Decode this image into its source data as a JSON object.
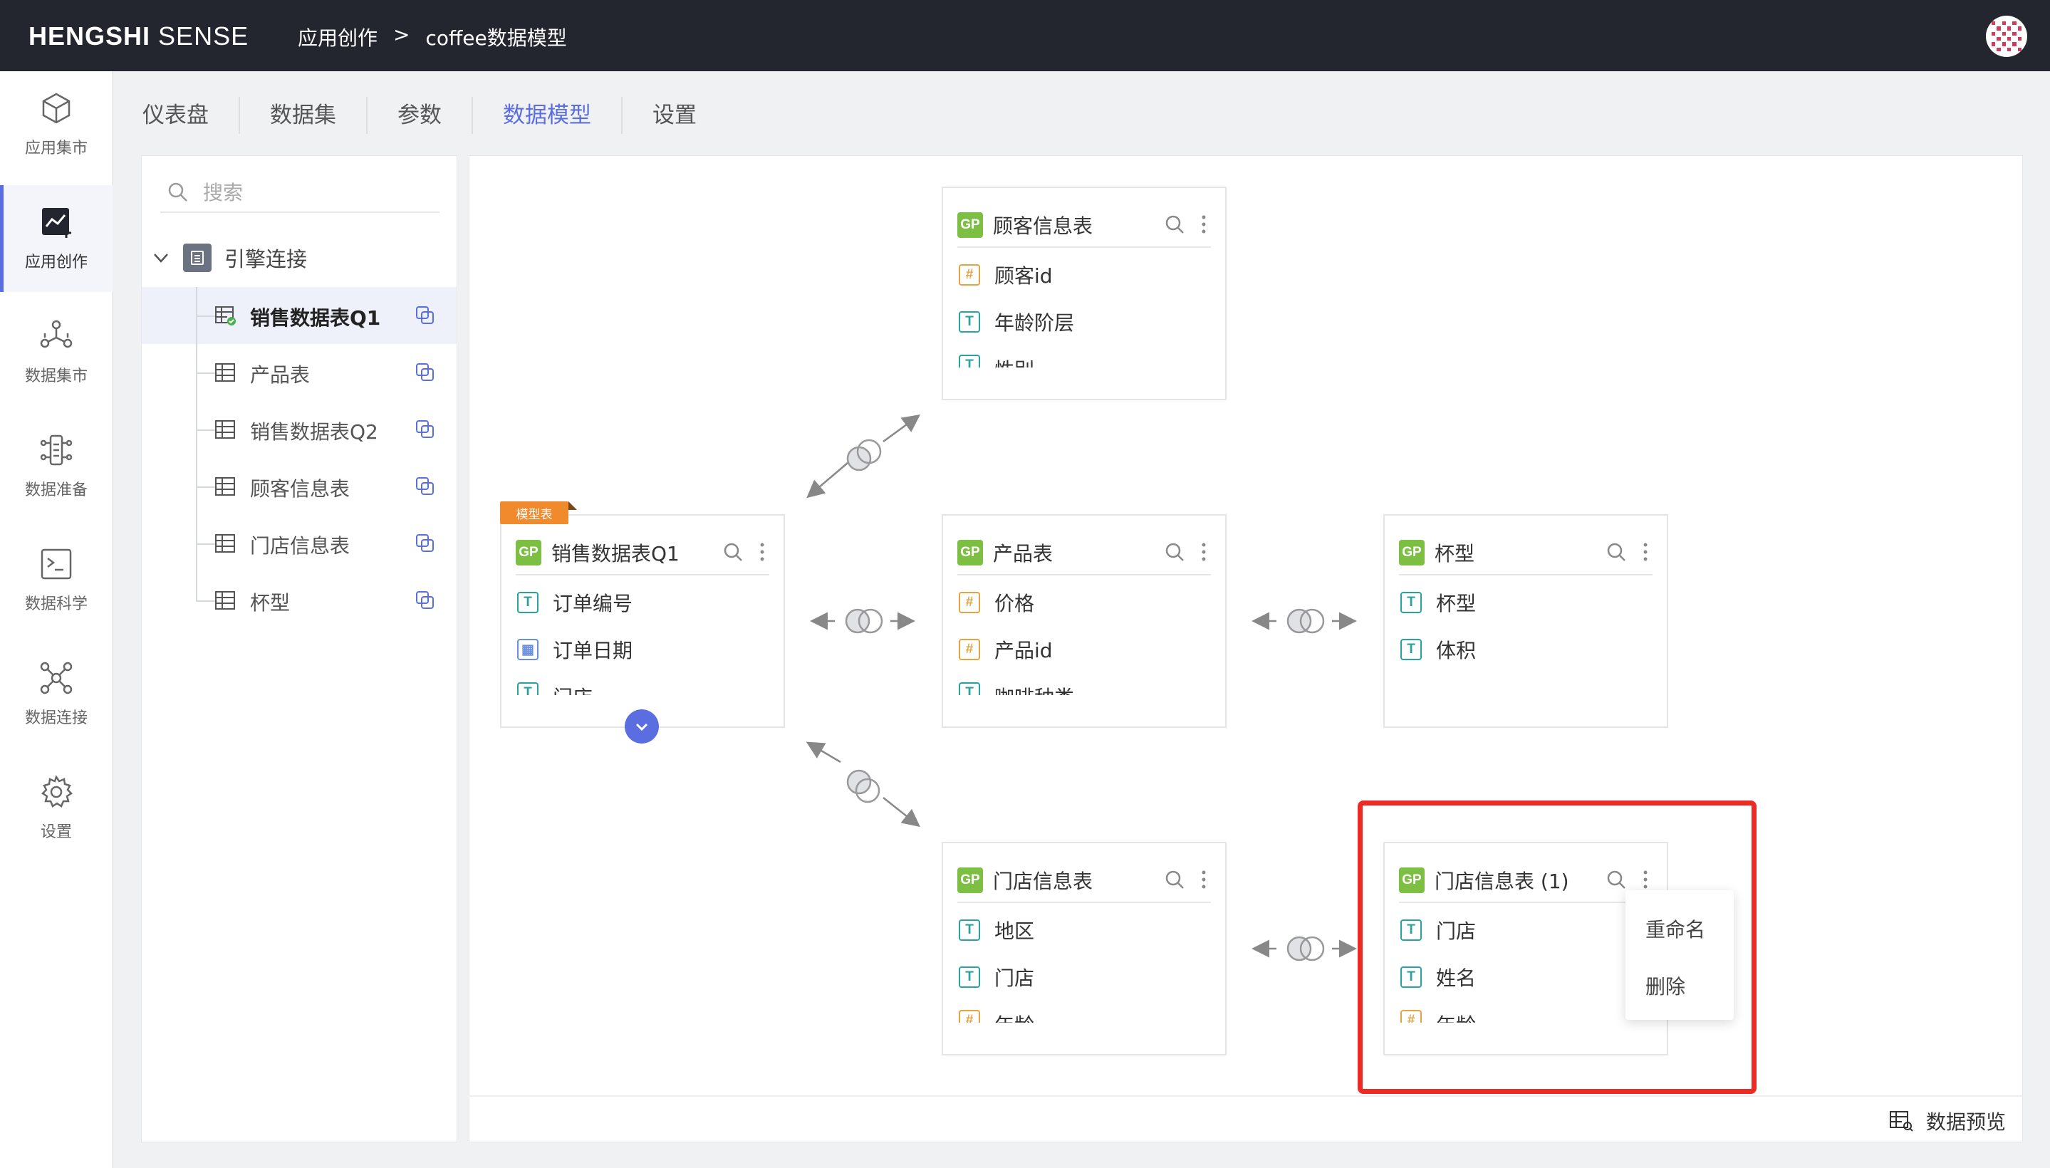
{
  "app": {
    "brand_bold": "HENGSHI",
    "brand_light": "SENSE",
    "breadcrumb": [
      "应用创作",
      ">",
      "coffee数据模型"
    ]
  },
  "leftnav": [
    {
      "label": "应用集市",
      "icon": "cube-icon"
    },
    {
      "label": "应用创作",
      "icon": "chart-create-icon",
      "active": true
    },
    {
      "label": "数据集市",
      "icon": "network-icon"
    },
    {
      "label": "数据准备",
      "icon": "flow-icon"
    },
    {
      "label": "数据科学",
      "icon": "terminal-icon"
    },
    {
      "label": "数据连接",
      "icon": "connection-icon"
    },
    {
      "label": "设置",
      "icon": "gear-icon"
    }
  ],
  "tabs": [
    {
      "label": "仪表盘"
    },
    {
      "label": "数据集"
    },
    {
      "label": "参数"
    },
    {
      "label": "数据模型",
      "active": true
    },
    {
      "label": "设置"
    }
  ],
  "panel": {
    "search_placeholder": "搜索",
    "root_label": "引擎连接",
    "items": [
      {
        "label": "销售数据表Q1",
        "active": true
      },
      {
        "label": "产品表"
      },
      {
        "label": "销售数据表Q2"
      },
      {
        "label": "顾客信息表"
      },
      {
        "label": "门店信息表"
      },
      {
        "label": "杯型"
      }
    ]
  },
  "model": {
    "badge": "模型表",
    "gp_label": "GP",
    "cards": {
      "customer": {
        "title": "顾客信息表",
        "fields": [
          {
            "type": "#",
            "label": "顾客id"
          },
          {
            "type": "T",
            "label": "年龄阶层"
          },
          {
            "type": "T",
            "label": "性别"
          }
        ]
      },
      "sales": {
        "title": "销售数据表Q1",
        "fields": [
          {
            "type": "T",
            "label": "订单编号"
          },
          {
            "type": "date",
            "label": "订单日期"
          },
          {
            "type": "T",
            "label": "门店"
          }
        ]
      },
      "product": {
        "title": "产品表",
        "fields": [
          {
            "type": "#",
            "label": "价格"
          },
          {
            "type": "#",
            "label": "产品id"
          },
          {
            "type": "T",
            "label": "咖啡种类"
          }
        ]
      },
      "cup": {
        "title": "杯型",
        "fields": [
          {
            "type": "T",
            "label": "杯型"
          },
          {
            "type": "T",
            "label": "体积"
          }
        ]
      },
      "store": {
        "title": "门店信息表",
        "fields": [
          {
            "type": "T",
            "label": "地区"
          },
          {
            "type": "T",
            "label": "门店"
          },
          {
            "type": "#",
            "label": "年龄"
          }
        ]
      },
      "store_copy": {
        "title": "门店信息表 (1)",
        "fields": [
          {
            "type": "T",
            "label": "门店"
          },
          {
            "type": "T",
            "label": "姓名"
          },
          {
            "type": "#",
            "label": "年龄"
          }
        ]
      }
    },
    "context_menu": [
      "重命名",
      "删除"
    ],
    "preview_label": "数据预览"
  }
}
